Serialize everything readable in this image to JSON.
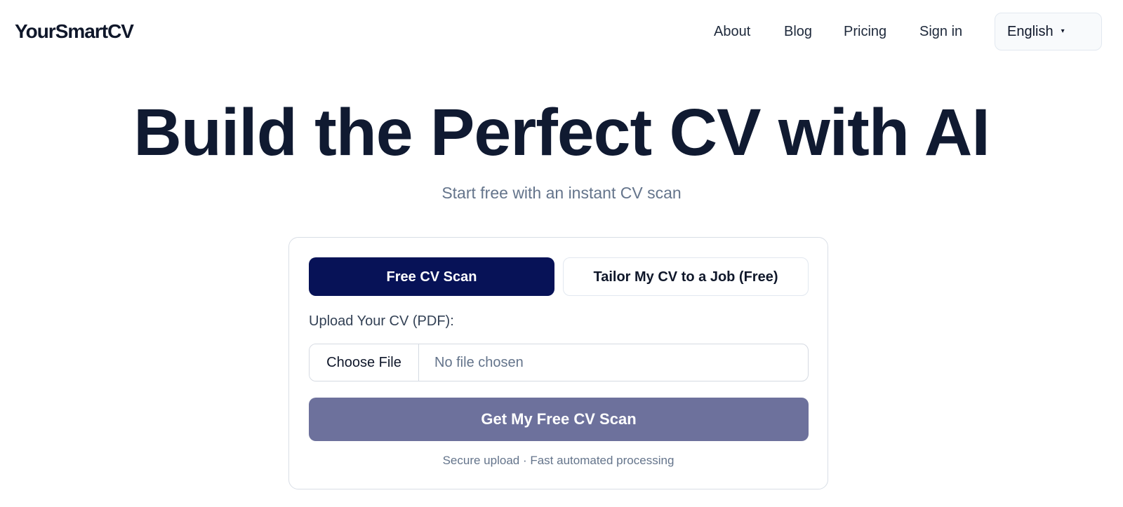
{
  "header": {
    "logo": "YourSmartCV",
    "nav": {
      "about": "About",
      "blog": "Blog",
      "pricing": "Pricing",
      "signin": "Sign in"
    },
    "language": {
      "selected": "English",
      "caret": "▾"
    }
  },
  "hero": {
    "title": "Build the Perfect CV with AI",
    "subtitle": "Start free with an instant CV scan"
  },
  "card": {
    "tabs": [
      {
        "label": "Free CV Scan",
        "active": true
      },
      {
        "label": "Tailor My CV to a Job (Free)",
        "active": false
      }
    ],
    "upload_label": "Upload Your CV (PDF):",
    "file_input": {
      "button_label": "Choose File",
      "status": "No file chosen"
    },
    "submit_label": "Get My Free CV Scan",
    "footnote": "Secure upload · Fast automated processing"
  },
  "colors": {
    "primary_navy": "#071257",
    "submit_disabled": "#6d719c",
    "heading": "#101a31",
    "muted_text": "#64748b"
  }
}
